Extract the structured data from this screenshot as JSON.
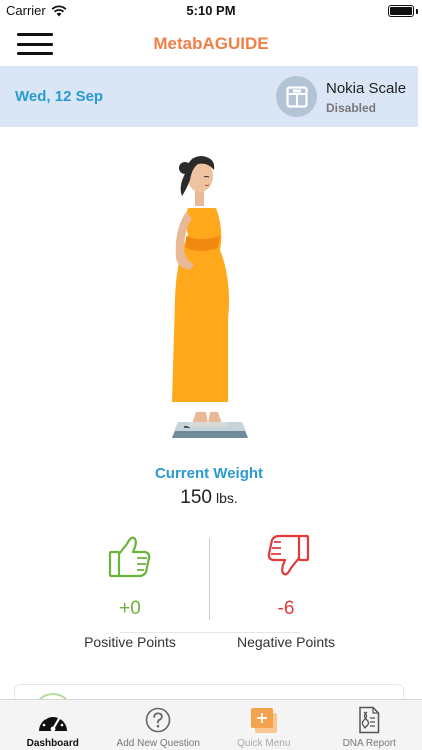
{
  "status_bar": {
    "carrier": "Carrier",
    "time": "5:10 PM",
    "battery_level": 1.0
  },
  "nav": {
    "title": "MetabAGUIDE",
    "menu_icon": "hamburger-menu-icon",
    "title_color": "#f07f46"
  },
  "banner": {
    "date": "Wed, 12 Sep",
    "scale_name": "Nokia Scale",
    "scale_status": "Disabled",
    "scale_icon": "scale-icon",
    "background": "#dae6f6",
    "date_color": "#2a9ad0"
  },
  "weight": {
    "label": "Current Weight",
    "value": "150",
    "unit": "lbs."
  },
  "points": {
    "positive": {
      "value": "+0",
      "label": "Positive Points",
      "icon": "thumbs-up-icon",
      "color": "#6bb43a"
    },
    "negative": {
      "value": "-6",
      "label": "Negative Points",
      "icon": "thumbs-down-icon",
      "color": "#e23a3a"
    }
  },
  "tabs": [
    {
      "label": "Dashboard",
      "icon": "dashboard-gauge-icon",
      "state": "active"
    },
    {
      "label": "Add New Question",
      "icon": "question-circle-icon",
      "state": "normal"
    },
    {
      "label": "Quick Menu",
      "icon": "quick-menu-plus-icon",
      "state": "disabled"
    },
    {
      "label": "DNA Report",
      "icon": "dna-report-icon",
      "state": "normal"
    }
  ]
}
